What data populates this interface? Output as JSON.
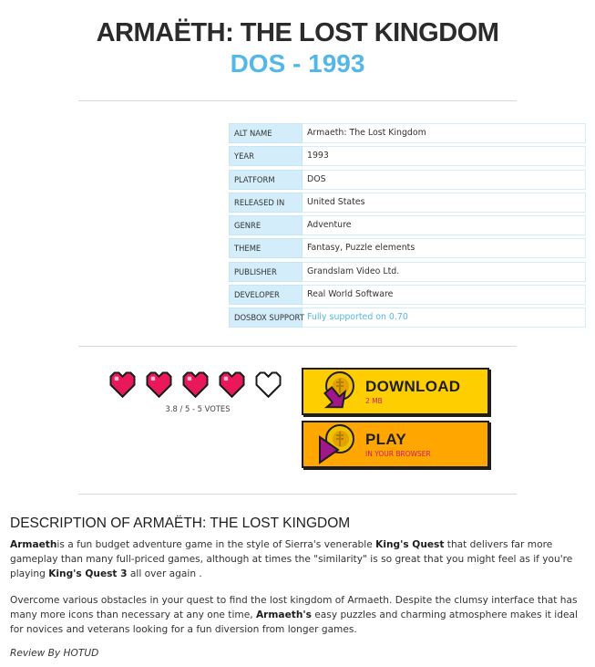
{
  "header": {
    "title": "ARMAËTH: THE LOST KINGDOM",
    "subtitle": "DOS - 1993"
  },
  "info": {
    "rows": [
      {
        "key": "ALT NAME",
        "value": "Armaeth: The Lost Kingdom"
      },
      {
        "key": "YEAR",
        "value": "1993"
      },
      {
        "key": "PLATFORM",
        "value": "DOS"
      },
      {
        "key": "RELEASED IN",
        "value": "United States"
      },
      {
        "key": "GENRE",
        "value": "Adventure"
      },
      {
        "key": "THEME",
        "value": "Fantasy, Puzzle elements"
      },
      {
        "key": "PUBLISHER",
        "value": "Grandslam Video Ltd."
      },
      {
        "key": "DEVELOPER",
        "value": "Real World Software"
      },
      {
        "key": "DOSBOX SUPPORT",
        "value": "Fully supported on 0.70"
      }
    ]
  },
  "rating": {
    "score": 3.8,
    "max": 5,
    "hearts_filled": 4,
    "votes_text": "3.8 / 5 - 5 VOTES"
  },
  "buttons": {
    "download": {
      "label": "DOWNLOAD",
      "sub": "2 MB",
      "icon": "download-arrow-icon"
    },
    "play": {
      "label": "PLAY",
      "sub": "IN YOUR BROWSER",
      "icon": "play-icon"
    }
  },
  "description": {
    "heading": "DESCRIPTION OF ARMAËTH: THE LOST KINGDOM",
    "p1": {
      "b1": "Armaeth",
      "t1": "is a fun budget adventure game in the style of Sierra's venerable ",
      "b2": "King's Quest",
      "t2": " that delivers far more gameplay than many full-priced games, although at times the \"similarity\" is so great that you might feel as if you're playing ",
      "b3": "King's Quest 3",
      "t3": " all over again ."
    },
    "p2": {
      "t1": "Overcome various obstacles in your quest to find the lost kingdom of Armaeth. Despite the clumsy interface that has many more icons than necessary at any one time, ",
      "b1": "Armaeth's",
      "t2": " easy puzzles and charming atmosphere makes it ideal for novices and veterans looking for a fun diversion from longer games."
    },
    "review": "Review By HOTUD"
  },
  "colors": {
    "accent": "#53b8e8",
    "heart": "#e8185a",
    "download_bg": "#ffce00",
    "play_bg": "#ffa700",
    "key_bg": "#d3eefa"
  }
}
